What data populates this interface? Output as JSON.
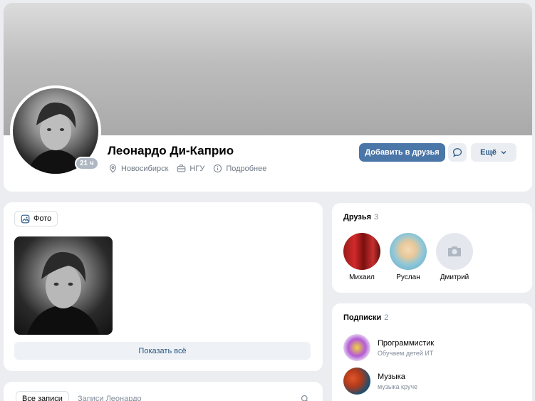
{
  "profile": {
    "name": "Леонардо Ди-Каприо",
    "last_seen": "21 ч",
    "city": "Новосибирск",
    "education": "НГУ",
    "more_info": "Подробнее",
    "add_friend_label": "Добавить в друзья",
    "more_label": "Ещё"
  },
  "photos": {
    "tag_label": "Фото",
    "show_all_label": "Показать всё"
  },
  "wall": {
    "tab_all": "Все записи",
    "tab_own": "Записи Леонардо"
  },
  "friends": {
    "title": "Друзья",
    "count": "3",
    "items": [
      {
        "name": "Михаил"
      },
      {
        "name": "Руслан"
      },
      {
        "name": "Дмитрий"
      }
    ]
  },
  "subscriptions": {
    "title": "Подписки",
    "count": "2",
    "items": [
      {
        "name": "Программистик",
        "description": "Обучаем детей ИТ"
      },
      {
        "name": "Музыка",
        "description": "музыка круче"
      }
    ]
  },
  "colors": {
    "accent": "#4a76a8",
    "link": "#2a5885",
    "background": "#ebedf0"
  }
}
